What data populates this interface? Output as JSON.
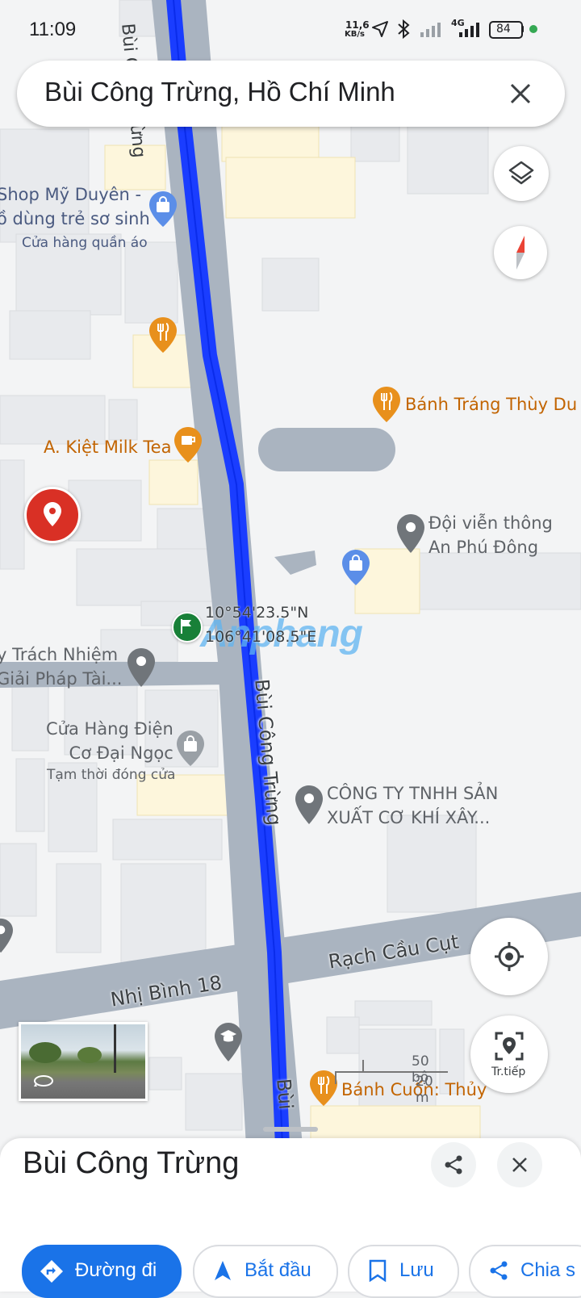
{
  "status_bar": {
    "time": "11:09",
    "net_speed_value": "11,6",
    "net_speed_unit": "KB/s",
    "network": "4G",
    "battery": "84"
  },
  "search": {
    "query": "Bùi Công Trừng, Hồ Chí Minh"
  },
  "map": {
    "street_main": "Bùi Công Trừng",
    "street_main_bottom": "Bùi",
    "street_right": "Rạch Cầu Cụt",
    "street_left": "Nhị Bình 18",
    "coord_lat": "10°54'23.5\"N",
    "coord_lon": "106°41'08.5\"E",
    "watermark": "Anphang",
    "poi": {
      "shop_line1": "Shop Mỹ Duyên -",
      "shop_line2": "ồ dùng trẻ sơ sinh",
      "shop_sub": "Cửa hàng quần áo",
      "banh_trang": "Bánh Tráng Thùy Du",
      "milk_tea": "A. Kiệt Milk Tea",
      "doi_vien_thong_1": "Đội viễn thông",
      "doi_vien_thong_2": "An Phú Đông",
      "trach_nhiem_1": "y Trách Nhiệm",
      "trach_nhiem_2": "Giải Pháp Tài...",
      "dien_co_1": "Cửa Hàng Điện",
      "dien_co_2": "Cơ Đại Ngọc",
      "dien_co_sub": "Tạm thời đóng cửa",
      "cong_ty_1": "CÔNG TY TNHH SẢN",
      "cong_ty_2": "XUẤT CƠ KHÍ XÂY...",
      "banh_cuon": "Bánh Cuốn: Thủy"
    },
    "scale_ft": "50 bộ",
    "scale_m": "20 m",
    "live_view_label": "Tr.tiếp"
  },
  "sheet": {
    "title": "Bùi Công Trừng",
    "chips": {
      "directions": "Đường đi",
      "start": "Bắt đầu",
      "save": "Lưu",
      "share": "Chia s"
    }
  },
  "colors": {
    "route": "#1a3dff",
    "accent": "#1a73e8",
    "poi_orange": "#e8901c",
    "poi_gray": "#70757a",
    "pin_red": "#d93025"
  }
}
